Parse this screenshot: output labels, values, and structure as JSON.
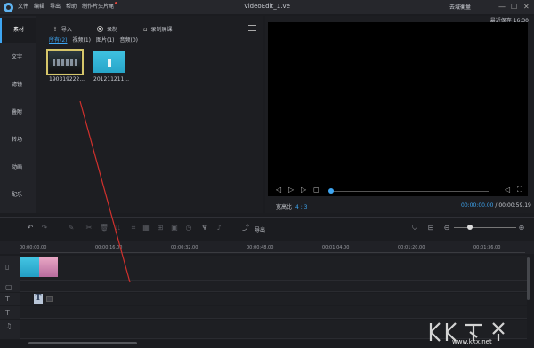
{
  "menu": [
    {
      "label": "文件"
    },
    {
      "label": "编辑"
    },
    {
      "label": "导出"
    },
    {
      "label": "帮助"
    },
    {
      "label": "制作片头片尾"
    }
  ],
  "window": {
    "title": "VideoEdit_1.ve",
    "login_label": "去域衡量",
    "min": "—",
    "max": "☐",
    "close": "✕"
  },
  "left_tabs": [
    {
      "label": "素材"
    },
    {
      "label": "文字"
    },
    {
      "label": "滤镜"
    },
    {
      "label": "叠附"
    },
    {
      "label": "转场"
    },
    {
      "label": "动画"
    },
    {
      "label": "配乐"
    }
  ],
  "media": {
    "import_label": "导入",
    "record_label": "录制",
    "screen_record_label": "录制屏课",
    "filters": [
      {
        "label": "所有(2)"
      },
      {
        "label": "视频(1)"
      },
      {
        "label": "图片(1)"
      },
      {
        "label": "音频(0)"
      }
    ],
    "items": [
      {
        "caption": "190319222..."
      },
      {
        "caption": "201211211..."
      }
    ]
  },
  "preview": {
    "last_save": "最近保存 16:30",
    "aspect_label": "宽高比",
    "aspect_value": "4 : 3",
    "time_current": "00:00:00.00",
    "time_total": "00:00:59.19",
    "progress": 0
  },
  "toolbar": {
    "export_label": "导出",
    "zoom": 0.25
  },
  "ruler": [
    {
      "label": "00:00:00.00"
    },
    {
      "label": "00:00:16.00"
    },
    {
      "label": "00:00:32.00"
    },
    {
      "label": "00:00:48.00"
    },
    {
      "label": "00:01:04.00"
    },
    {
      "label": "00:01:20.00"
    },
    {
      "label": "00:01:36.00"
    }
  ],
  "watermark": {
    "site": "www.kkx.net"
  },
  "colors": {
    "accent": "#3ea6f2",
    "annotation": "#d0312d"
  }
}
